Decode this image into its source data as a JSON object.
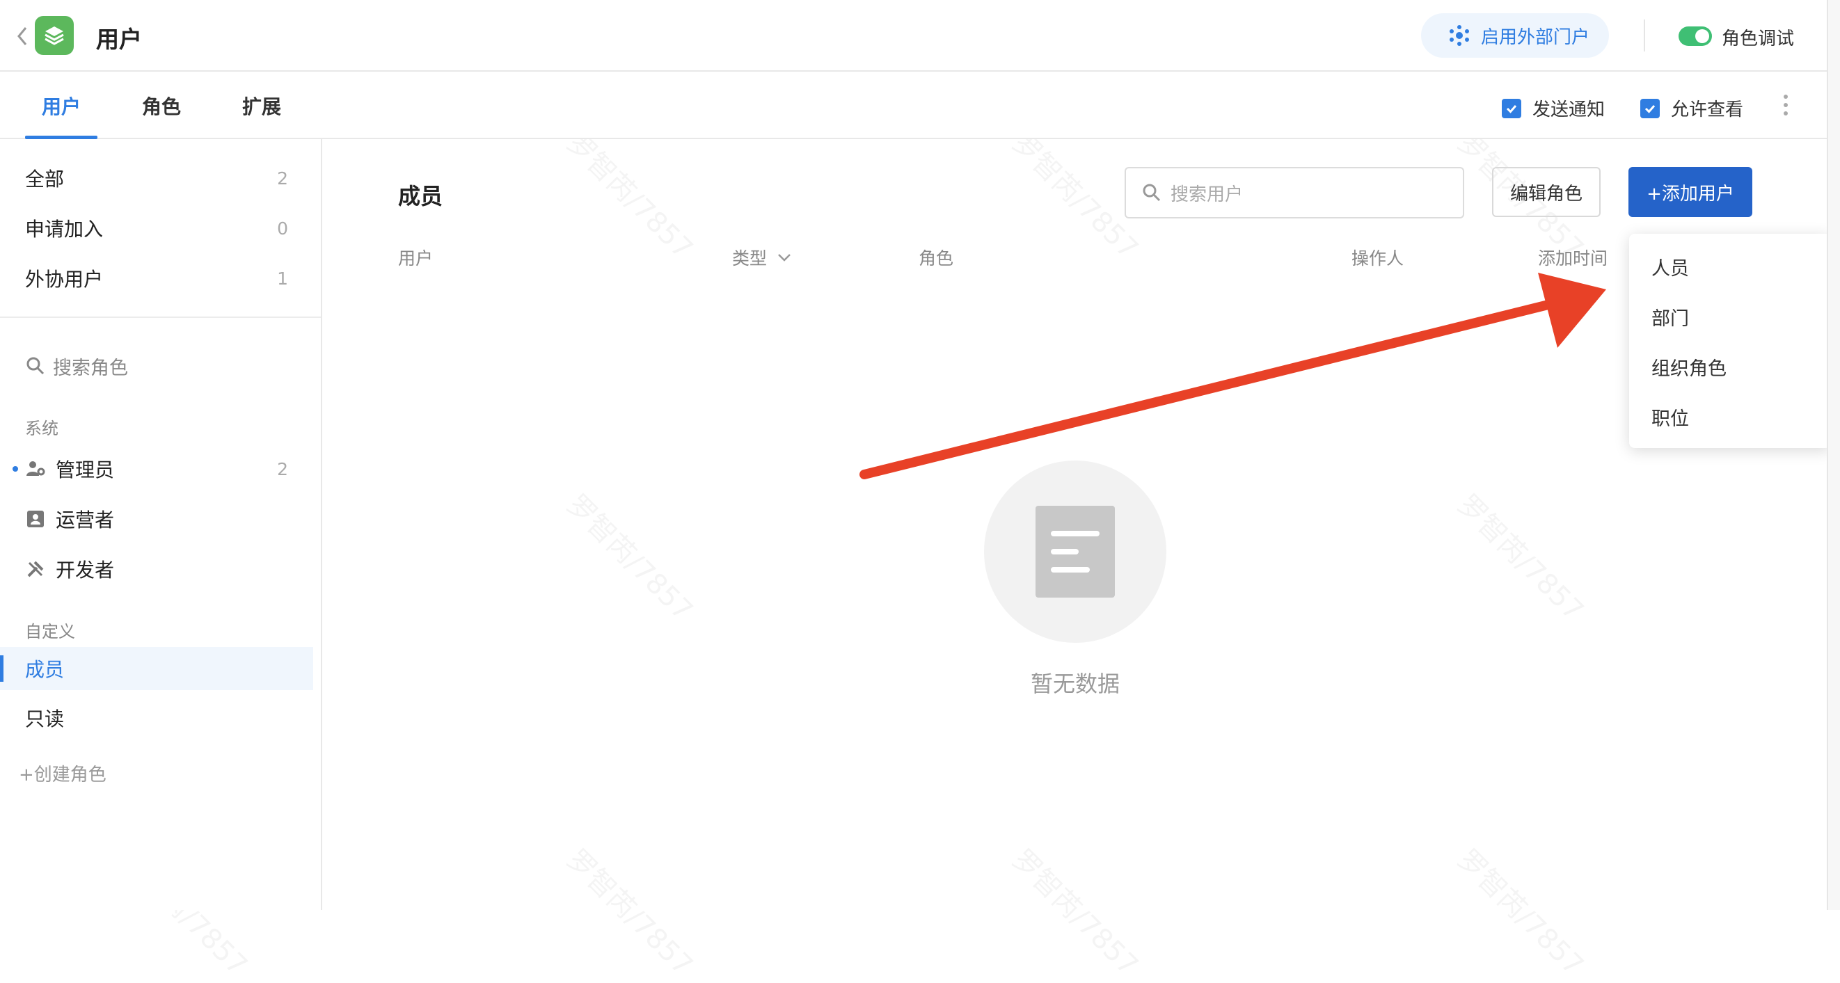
{
  "header": {
    "title": "用户",
    "portal_button": "启用外部门户",
    "role_debug_label": "角色调试",
    "role_debug_on": true
  },
  "tabs": [
    {
      "label": "用户",
      "active": true
    },
    {
      "label": "角色",
      "active": false
    },
    {
      "label": "扩展",
      "active": false
    }
  ],
  "toolbar": {
    "send_notice_label": "发送通知",
    "allow_view_label": "允许查看"
  },
  "sidebar": {
    "groups": [
      {
        "label": "全部",
        "count": "2"
      },
      {
        "label": "申请加入",
        "count": "0"
      },
      {
        "label": "外协用户",
        "count": "1"
      }
    ],
    "search_placeholder": "搜索角色",
    "system_title": "系统",
    "system_roles": [
      {
        "label": "管理员",
        "count": "2",
        "icon": "user-gear-icon"
      },
      {
        "label": "运营者",
        "icon": "contact-card-icon"
      },
      {
        "label": "开发者",
        "icon": "tools-icon"
      }
    ],
    "custom_title": "自定义",
    "custom_roles": [
      {
        "label": "成员",
        "active": true
      },
      {
        "label": "只读",
        "active": false
      }
    ],
    "create_role_label": "+创建角色"
  },
  "main": {
    "title": "成员",
    "search_placeholder": "搜索用户",
    "edit_role_button": "编辑角色",
    "add_user_button": "+添加用户",
    "columns": [
      "用户",
      "类型",
      "角色",
      "操作人",
      "添加时间"
    ],
    "empty_text": "暂无数据"
  },
  "add_user_menu": {
    "items": [
      "人员",
      "部门",
      "组织角色",
      "职位"
    ]
  },
  "watermark": "罗智芮/7857",
  "colors": {
    "accent": "#2f7de1",
    "primary_button": "#2563c9",
    "app_icon": "#5cb85c",
    "toggle_on": "#3fbf74",
    "annotation_arrow": "#e84127"
  }
}
